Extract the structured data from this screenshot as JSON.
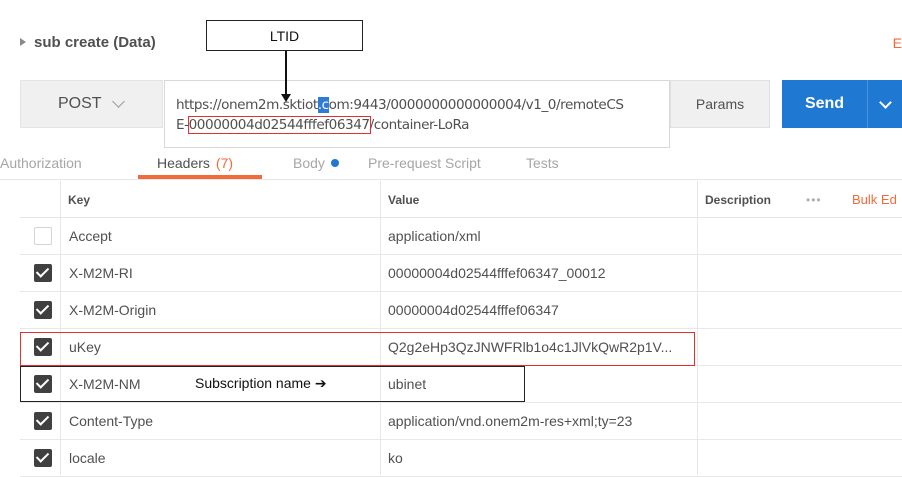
{
  "request": {
    "name": "sub create (Data)",
    "edit_label": "E",
    "method": "POST",
    "url_part1": "https://onem2m.sktiot",
    "url_sel": ".c",
    "url_part2": "om:9443/0000000000000004/v1_0/remoteCS",
    "url_part3": "E-",
    "url_ltid": "00000004d02544fffef06347",
    "url_part4": "/container-LoRa",
    "params_label": "Params",
    "send_label": "Send"
  },
  "tabs": {
    "authorization": "Authorization",
    "headers": "Headers",
    "headers_count": "(7)",
    "body": "Body",
    "prerequest": "Pre-request Script",
    "tests": "Tests"
  },
  "table": {
    "col_key": "Key",
    "col_value": "Value",
    "col_description": "Description",
    "more": "•••",
    "bulk_edit": "Bulk Ed",
    "rows": [
      {
        "checked": false,
        "key": "Accept",
        "value": "application/xml"
      },
      {
        "checked": true,
        "key": "X-M2M-RI",
        "value": "00000004d02544fffef06347_00012"
      },
      {
        "checked": true,
        "key": "X-M2M-Origin",
        "value": "00000004d02544fffef06347"
      },
      {
        "checked": true,
        "key": "uKey",
        "value": "Q2g2eHp3QzJNWFRlb1o4c1JlVkQwR2p1V..."
      },
      {
        "checked": true,
        "key": "X-M2M-NM",
        "value": "ubinet"
      },
      {
        "checked": true,
        "key": "Content-Type",
        "value": "application/vnd.onem2m-res+xml;ty=23"
      },
      {
        "checked": true,
        "key": "locale",
        "value": "ko"
      }
    ]
  },
  "annotations": {
    "ltid_label": "LTID",
    "subscription_note": "Subscription name ➔"
  }
}
